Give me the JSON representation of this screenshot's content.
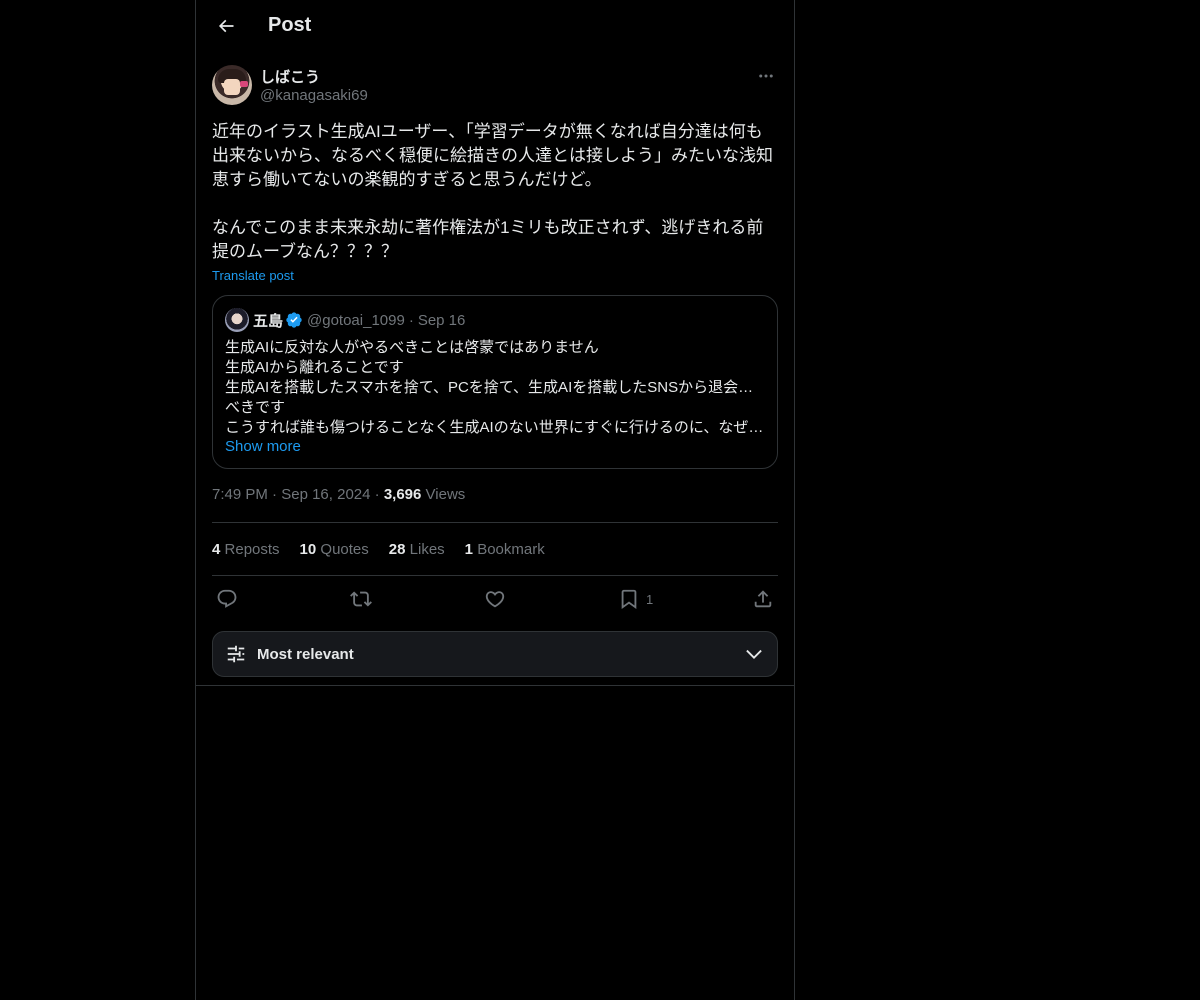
{
  "header": {
    "title": "Post"
  },
  "post": {
    "author": {
      "display_name": "しばこう",
      "handle": "@kanagasaki69"
    },
    "text": "近年のイラスト生成AIユーザー、「学習データが無くなれば自分達は何も\n出来ないから、なるべく穏便に絵描きの人達とは接しよう」みたいな浅知\n恵すら働いてないの楽観的すぎると思うんだけど。\n\nなんでこのまま未来永劫に著作権法が1ミリも改正されず、逃げきれる前\n提のムーブなん？？？？",
    "translate_label": "Translate post",
    "quote": {
      "name": "五島",
      "handle": "@gotoai_1099",
      "separator": "·",
      "date": "Sep 16",
      "lines": [
        "生成AIに反対な人がやるべきことは啓蒙ではありません",
        "生成AIから離れることです",
        "生成AIを搭載したスマホを捨て、PCを捨て、生成AIを搭載したSNSから退会する",
        "べきです",
        "こうすれば誰も傷つけることなく生成AIのない世界にすぐに行けるのに、なぜ…"
      ],
      "show_more": "Show more"
    },
    "meta": {
      "time": "7:49 PM",
      "separator": "·",
      "date": "Sep 16, 2024",
      "views_count": "3,696",
      "views_label": "Views"
    },
    "stats": {
      "reposts_count": "4",
      "reposts_label": "Reposts",
      "quotes_count": "10",
      "quotes_label": "Quotes",
      "likes_count": "28",
      "likes_label": "Likes",
      "bookmarks_count": "1",
      "bookmarks_label": "Bookmark"
    },
    "actions": {
      "bookmark_count": "1"
    }
  },
  "sort": {
    "label": "Most relevant"
  },
  "colors": {
    "accent": "#1d9bf0",
    "muted": "#71767b",
    "text": "#e7e9ea",
    "border": "#2f3336"
  }
}
